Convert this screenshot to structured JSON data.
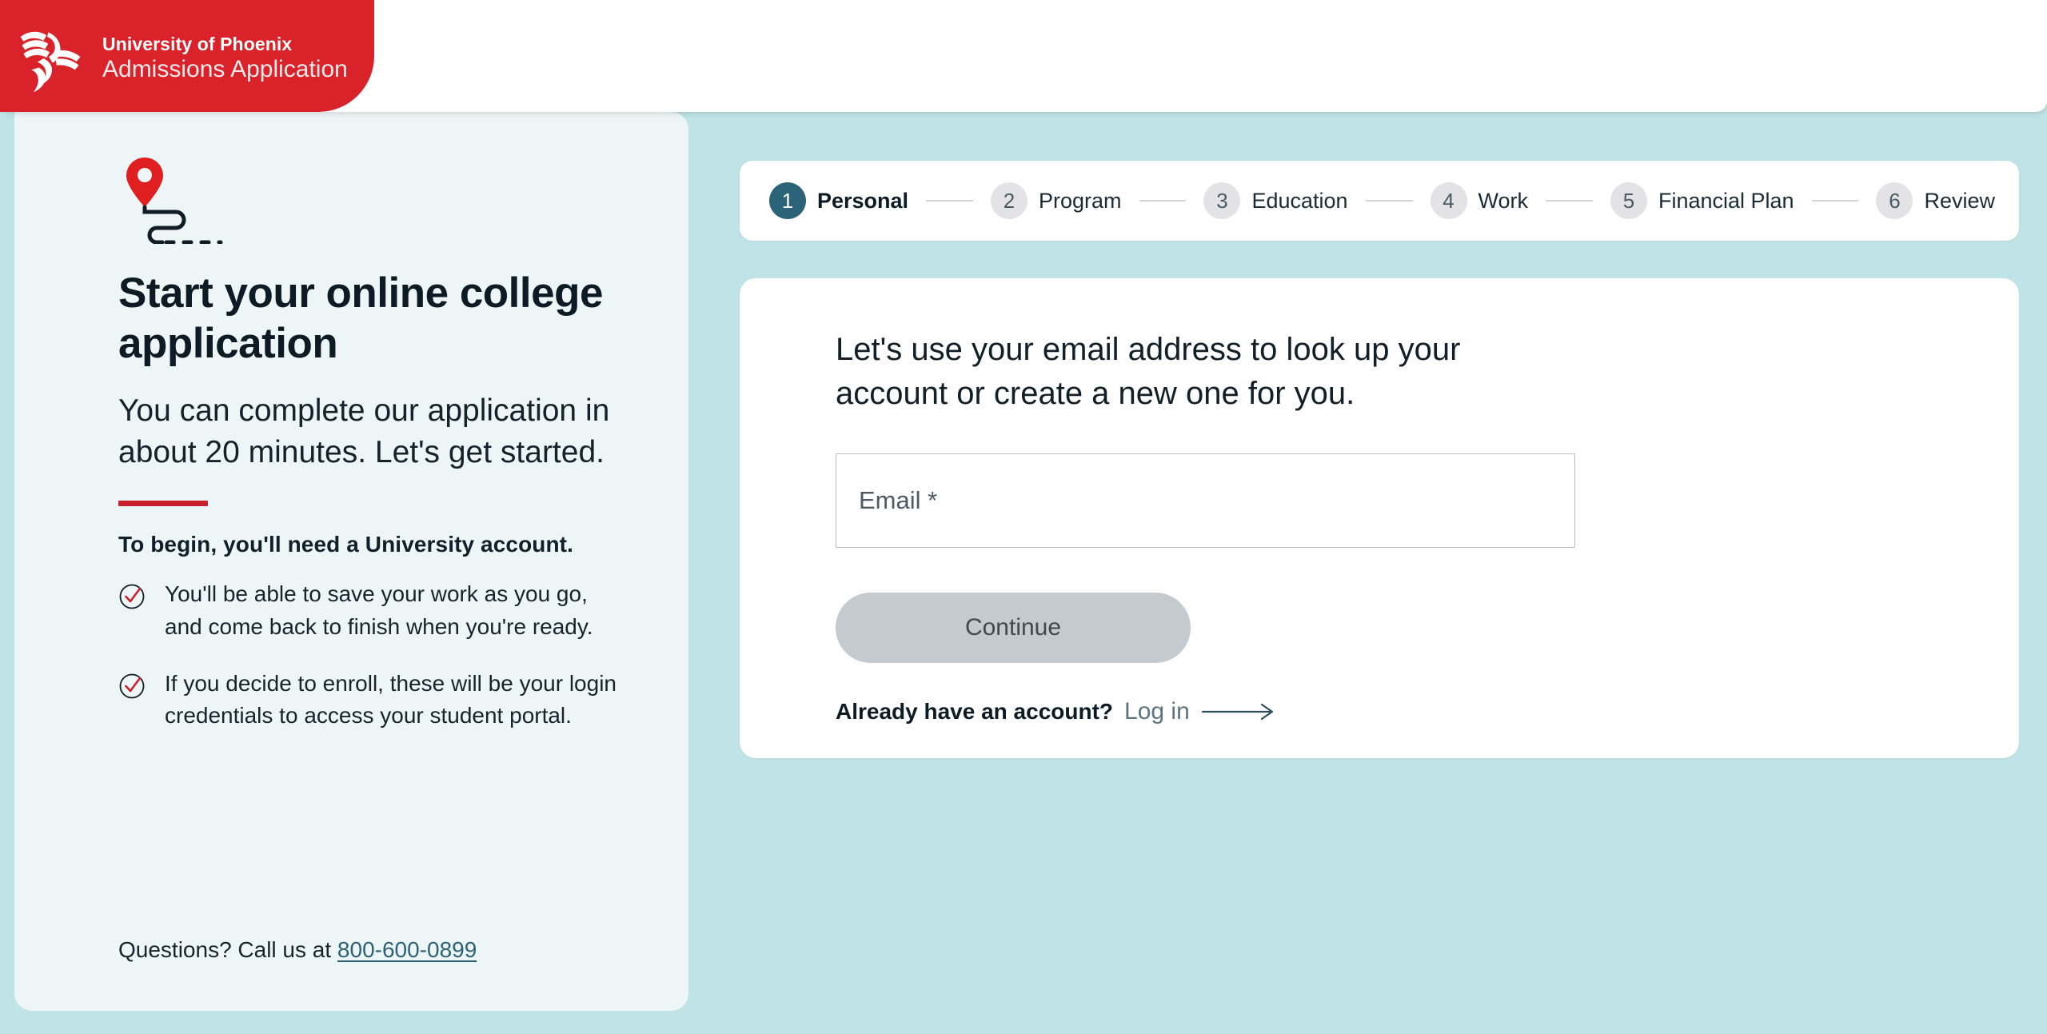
{
  "brand": {
    "logo_icon": "phoenix-bird-logo",
    "name": "University of Phoenix",
    "subtitle": "Admissions Application",
    "red": "#d9222a",
    "accent_teal": "#2d6378"
  },
  "left_panel": {
    "icon": "map-pin-route-icon",
    "title": "Start your online college application",
    "subtitle": "You can complete our application in about 20 minutes. Let's get started.",
    "need_account_heading": "To begin, you'll need a University account.",
    "bullets": [
      {
        "icon": "check-circle-icon",
        "text": "You'll be able to save your work as you go, and come back to finish when you're ready."
      },
      {
        "icon": "check-circle-icon",
        "text": "If you decide to enroll, these will be your login credentials to access your student portal."
      }
    ],
    "call_prefix": "Questions? Call us at",
    "phone": "800-600-0899"
  },
  "stepper": {
    "current_step": 1,
    "steps": [
      {
        "number": "1",
        "label": "Personal",
        "state": "active"
      },
      {
        "number": "2",
        "label": "Program",
        "state": "inactive"
      },
      {
        "number": "3",
        "label": "Education",
        "state": "inactive"
      },
      {
        "number": "4",
        "label": "Work",
        "state": "inactive"
      },
      {
        "number": "5",
        "label": "Financial Plan",
        "state": "inactive"
      },
      {
        "number": "6",
        "label": "Review",
        "state": "inactive"
      }
    ]
  },
  "form": {
    "heading": "Let's use your email address to look up your account or create a new one for you.",
    "email": {
      "label": "Email *",
      "value": "",
      "placeholder": "Email *"
    },
    "continue_label": "Continue",
    "continue_enabled": false,
    "already_account_label": "Already have an account?",
    "login_label": "Log in",
    "login_arrow_icon": "long-arrow-right-icon"
  }
}
